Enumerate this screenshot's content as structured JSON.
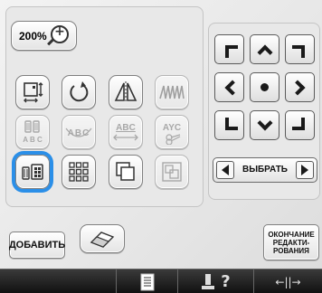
{
  "zoom": {
    "label": "200%"
  },
  "edit_buttons": {
    "row1": [
      {
        "name": "size-button",
        "icon": "resize-icon"
      },
      {
        "name": "rotate-button",
        "icon": "rotate-icon"
      },
      {
        "name": "mirror-button",
        "icon": "mirror-icon"
      },
      {
        "name": "density-button",
        "icon": "stitch-density-icon",
        "disabled": true
      }
    ],
    "row2": [
      {
        "name": "multicolor-text-button",
        "icon": "multicolor-icon",
        "disabled": true,
        "text": "A B C"
      },
      {
        "name": "array-curve-button",
        "icon": "text-curve-icon",
        "disabled": true,
        "text": "ABC"
      },
      {
        "name": "spacing-button",
        "icon": "text-spacing-icon",
        "disabled": true,
        "text": "ABC"
      },
      {
        "name": "letter-cut-button",
        "icon": "letter-cut-icon",
        "disabled": true,
        "text": "AYC"
      }
    ],
    "row3": [
      {
        "name": "color-change-button",
        "icon": "thread-color-icon",
        "selected": true
      },
      {
        "name": "border-button",
        "icon": "border-grid-icon"
      },
      {
        "name": "duplicate-button",
        "icon": "duplicate-icon"
      },
      {
        "name": "group-button",
        "icon": "group-icon",
        "disabled": true
      }
    ]
  },
  "select": {
    "label": "ВЫБРАТЬ"
  },
  "footer": {
    "add_label": "ДОБАВИТЬ",
    "end_label_1": "ОКОНЧАНИЕ",
    "end_label_2": "РЕДАКТИ-",
    "end_label_3": "РОВАНИЯ"
  },
  "bottom_bar": {
    "help_text": "?",
    "move_text": "←||→"
  },
  "colors": {
    "selection": "#2b8fe8",
    "disabled_icon": "#a8a8a8",
    "bottom_bar": "#1e1e1e"
  }
}
